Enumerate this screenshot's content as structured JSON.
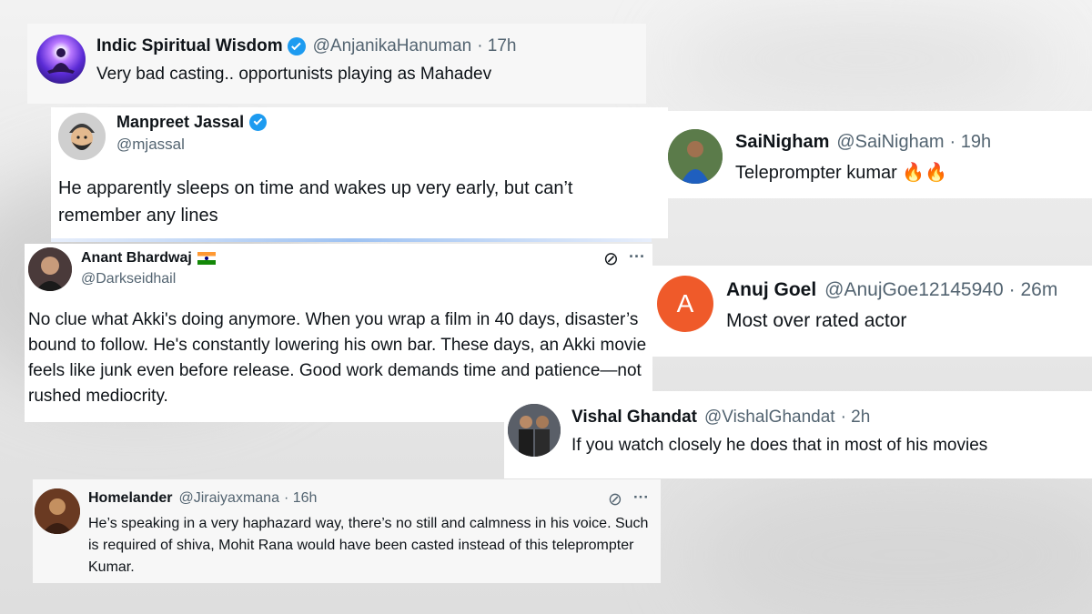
{
  "tweets": [
    {
      "name": "Indic Spiritual Wisdom",
      "handle": "@AnjanikaHanuman",
      "time": "· 17h",
      "text": "Very bad casting.. opportunists playing as Mahadev",
      "verified": true
    },
    {
      "name": "Manpreet Jassal",
      "handle": "@mjassal",
      "text": "He apparently sleeps on time and wakes up very early, but can’t remember any lines",
      "verified": true
    },
    {
      "name": "SaiNigham",
      "handle": "@SaiNigham",
      "time": "· 19h",
      "text": "Teleprompter kumar 🔥🔥"
    },
    {
      "name": "Anant Bhardwaj",
      "handle": "@Darkseidhail",
      "text": "No clue what Akki's doing anymore. When you wrap a film in 40 days, disaster’s bound to follow. He's constantly lowering his own bar. These days, an Akki movie feels like junk even before release. Good work demands time and patience—not rushed mediocrity.",
      "grok_icon": "grok-icon",
      "more_label": "···"
    },
    {
      "name": "Anuj Goel",
      "handle": "@AnujGoe12145940",
      "time": "· 26m",
      "text": "Most over rated actor",
      "avatar_letter": "A",
      "avatar_color": "#ef5a2a"
    },
    {
      "name": "Vishal Ghandat",
      "handle": "@VishalGhandat",
      "time": "· 2h",
      "text": "If you watch closely he does that in most of his movies"
    },
    {
      "name": "Homelander",
      "handle": "@Jiraiyaxmana",
      "time": "· 16h",
      "text": "He’s speaking in a very haphazard way, there’s no still and calmness in his voice. Such is required of shiva, Mohit Rana would have been casted instead of this teleprompter Kumar.",
      "grok_icon": "grok-icon",
      "more_label": "···"
    }
  ],
  "colors": {
    "verified": "#1d9bf0",
    "text": "#0f1419",
    "muted": "#536471"
  }
}
